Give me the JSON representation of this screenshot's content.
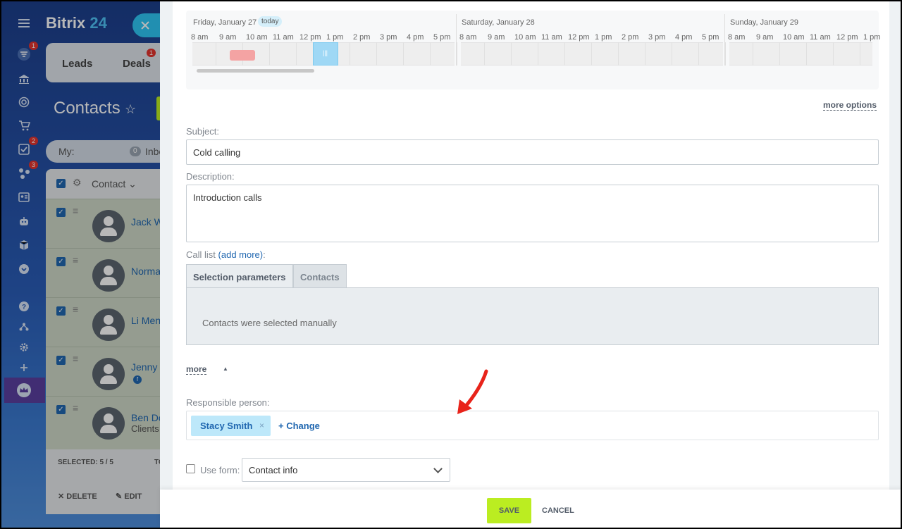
{
  "app": {
    "brand_name": "Bitrix",
    "brand_num": "24"
  },
  "rail": {
    "badges": {
      "filter": "1",
      "tasks": "2",
      "network": "3"
    }
  },
  "crm": {
    "tabs": [
      {
        "label": "Leads"
      },
      {
        "label": "Deals",
        "badge": "1"
      }
    ],
    "page_title": "Contacts",
    "filter": {
      "label": "My:",
      "count": "0",
      "name": "Inbound"
    },
    "grid": {
      "column": "Contact",
      "rows": [
        {
          "name": "Jack W"
        },
        {
          "name": "Norma"
        },
        {
          "name": "Li Men"
        },
        {
          "name": "Jenny"
        },
        {
          "name": "Ben Do",
          "sub": "Clients"
        }
      ],
      "selected": "SELECTED: 5 / 5",
      "total_prefix": "TO",
      "delete_label": "DELETE",
      "edit_label": "EDIT"
    }
  },
  "activity": {
    "schedule": {
      "days": [
        {
          "label": "Friday, January 27",
          "today": "today",
          "hours": [
            "8 am",
            "9 am",
            "10 am",
            "11 am",
            "12 pm",
            "1 pm",
            "2 pm",
            "3 pm",
            "4 pm",
            "5 pm"
          ]
        },
        {
          "label": "Saturday, January 28",
          "hours": [
            "8 am",
            "9 am",
            "10 am",
            "11 am",
            "12 pm",
            "1 pm",
            "2 pm",
            "3 pm",
            "4 pm",
            "5 pm"
          ]
        },
        {
          "label": "Sunday, January 29",
          "hours": [
            "8 am",
            "9 am",
            "10 am",
            "11 am",
            "12 pm",
            "1 pm"
          ]
        }
      ],
      "current_marker": "|||"
    },
    "more_options": "more options",
    "subject_label": "Subject:",
    "subject_value": "Cold calling",
    "description_label": "Description:",
    "description_value": "Introduction calls",
    "call_list_label": "Call list",
    "call_list_link": "(add more)",
    "call_list_colon": ":",
    "tabs": [
      "Selection parameters",
      "Contacts"
    ],
    "tab_body_text": "Contacts were selected manually",
    "more_label": "more",
    "responsible_label": "Responsible person:",
    "responsible_name": "Stacy Smith",
    "remove_glyph": "×",
    "change_label": "+ Change",
    "use_form_label": "Use form:",
    "use_form_value": "Contact info",
    "save_label": "SAVE",
    "cancel_label": "CANCEL"
  },
  "colors": {
    "accent": "#2067b0",
    "save": "#bbed21",
    "busy": "#f4a3a3",
    "arrow": "#e8231a"
  }
}
